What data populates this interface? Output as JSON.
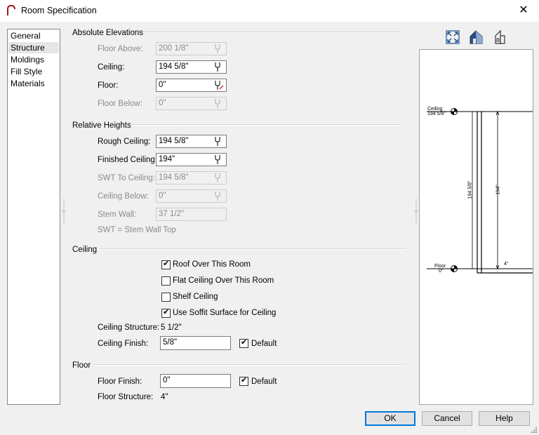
{
  "window": {
    "title": "Room Specification",
    "close_glyph": "✕"
  },
  "nav": {
    "items": [
      "General",
      "Structure",
      "Moldings",
      "Fill Style",
      "Materials"
    ],
    "selected": "Structure"
  },
  "absolute_elevations": {
    "title": "Absolute Elevations",
    "floor_above": {
      "label": "Floor Above:",
      "value": "200 1/8\""
    },
    "ceiling": {
      "label": "Ceiling:",
      "value": "194 5/8\""
    },
    "floor": {
      "label": "Floor:",
      "value": "0\""
    },
    "floor_below": {
      "label": "Floor Below:",
      "value": "0\""
    }
  },
  "relative_heights": {
    "title": "Relative Heights",
    "rough_ceiling": {
      "label": "Rough Ceiling:",
      "value": "194 5/8\""
    },
    "finished_ceiling": {
      "label": "Finished Ceiling:",
      "value": "194\""
    },
    "swt_to_ceiling": {
      "label": "SWT To Ceiling:",
      "value": "194 5/8\""
    },
    "ceiling_below": {
      "label": "Ceiling Below:",
      "value": "0\""
    },
    "stem_wall": {
      "label": "Stem Wall:",
      "value": "37 1/2\""
    },
    "note": "SWT = Stem Wall Top"
  },
  "ceiling": {
    "title": "Ceiling",
    "checkboxes": [
      {
        "label": "Roof Over This Room",
        "checked": true
      },
      {
        "label": "Flat Ceiling Over This Room",
        "checked": false
      },
      {
        "label": "Shelf Ceiling",
        "checked": false
      },
      {
        "label": "Use Soffit Surface for Ceiling",
        "checked": true
      }
    ],
    "structure": {
      "label": "Ceiling Structure:",
      "value": "5 1/2\""
    },
    "finish": {
      "label": "Ceiling Finish:",
      "value": "5/8\""
    },
    "default_label": "Default",
    "default_checked": true
  },
  "floor": {
    "title": "Floor",
    "finish": {
      "label": "Floor Finish:",
      "value": "0\""
    },
    "default_label": "Default",
    "default_checked": true,
    "structure": {
      "label": "Floor Structure:",
      "value": "4\""
    }
  },
  "preview": {
    "ceiling_label": "Ceiling",
    "ceiling_value": "194 5/8\"",
    "floor_label": "Floor",
    "floor_value": "0\"",
    "dim_left": "194 5/8\"",
    "dim_right": "194\"",
    "dim_small": "4\""
  },
  "buttons": {
    "ok": "OK",
    "cancel": "Cancel",
    "help": "Help"
  },
  "colors": {
    "accent": "#0078d7",
    "logo": "#9b1b1b"
  }
}
